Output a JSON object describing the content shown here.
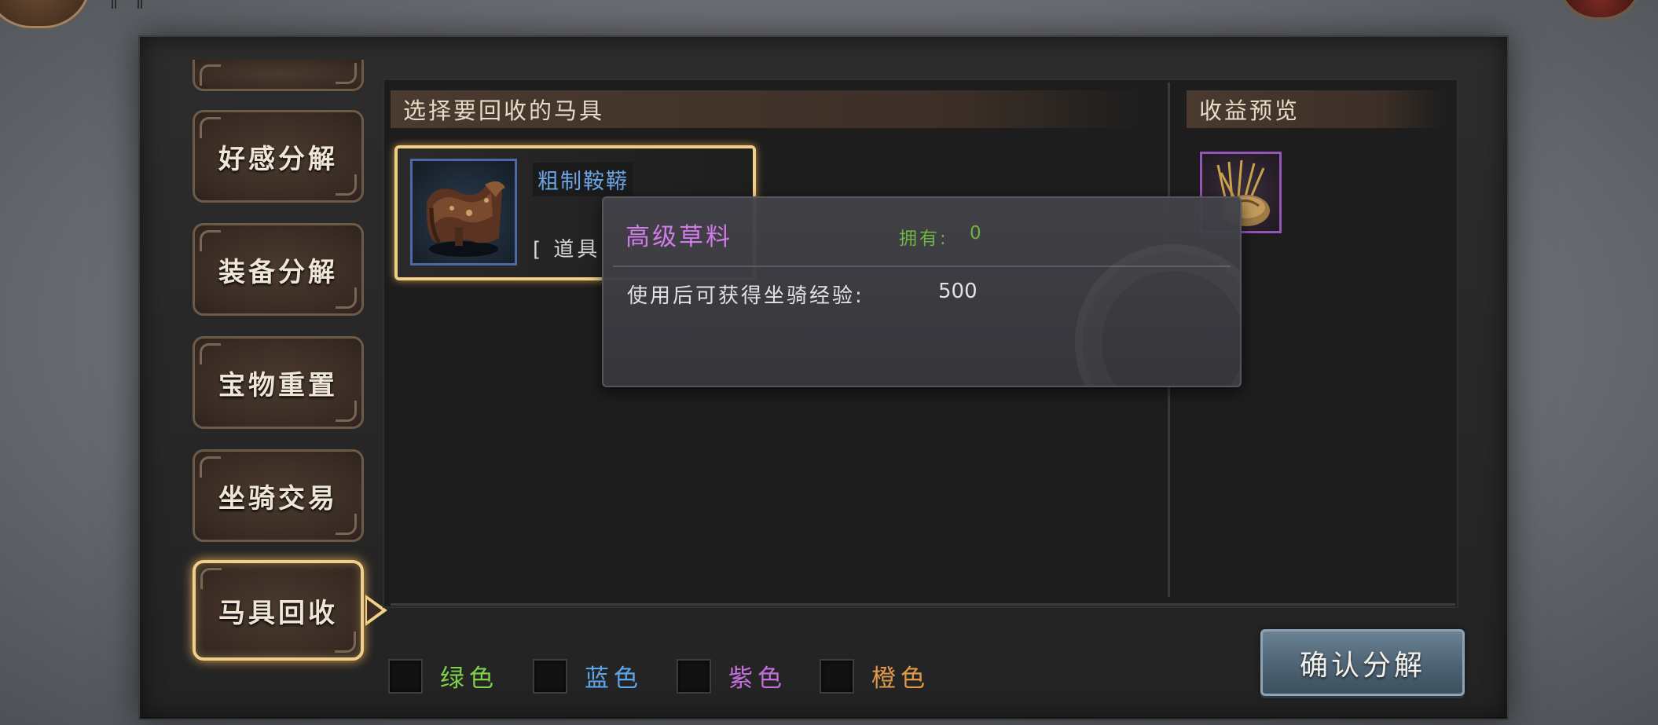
{
  "tabs": [
    {
      "label": "好感分解"
    },
    {
      "label": "装备分解"
    },
    {
      "label": "宝物重置"
    },
    {
      "label": "坐骑交易"
    },
    {
      "label": "马具回收"
    }
  ],
  "active_tab": "马具回收",
  "select_section": {
    "header": "选择要回收的马具",
    "item": {
      "name": "粗制鞍鞯",
      "type_label": "[ 道具",
      "name_color": "#6ca5e6"
    }
  },
  "reward_section": {
    "header": "收益预览",
    "reward_rarity_color": "#9356b8"
  },
  "tooltip": {
    "title": "高级草料",
    "title_color": "#d17be8",
    "owned_label": "拥有:",
    "owned_value": "0",
    "description": "使用后可获得坐骑经验:",
    "description_value": "500"
  },
  "filters": [
    {
      "label": "绿色",
      "color": "#7fd14a"
    },
    {
      "label": "蓝色",
      "color": "#5ea6e8"
    },
    {
      "label": "紫色",
      "color": "#c46fdb"
    },
    {
      "label": "橙色",
      "color": "#e39a48"
    }
  ],
  "confirm_button": {
    "label": "确认分解"
  }
}
